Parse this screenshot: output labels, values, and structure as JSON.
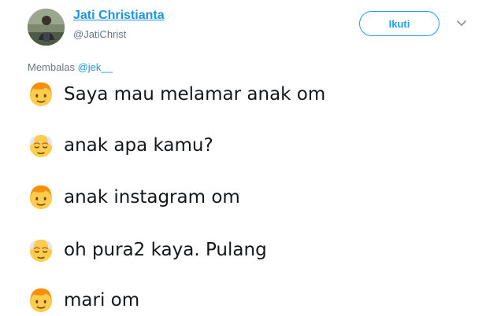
{
  "tweet": {
    "author": {
      "name": "Jati Christianta",
      "handle": "@JatiChrist"
    },
    "follow_label": "Ikuti",
    "reply": {
      "prefix": "Membalas",
      "mention": "@jek__"
    },
    "lines": [
      {
        "icon": "boy-emoji-icon",
        "text": "Saya mau melamar anak om"
      },
      {
        "icon": "old-man-emoji-icon",
        "text": "anak apa kamu?"
      },
      {
        "icon": "boy-emoji-icon",
        "text": "anak instagram om"
      },
      {
        "icon": "old-man-emoji-icon",
        "text": "oh pura2 kaya. Pulang"
      },
      {
        "icon": "boy-emoji-icon",
        "text": "mari om"
      }
    ]
  },
  "colors": {
    "link": "#1b95e0",
    "accent": "#1da1f2",
    "muted": "#657786",
    "text": "#14171a"
  }
}
